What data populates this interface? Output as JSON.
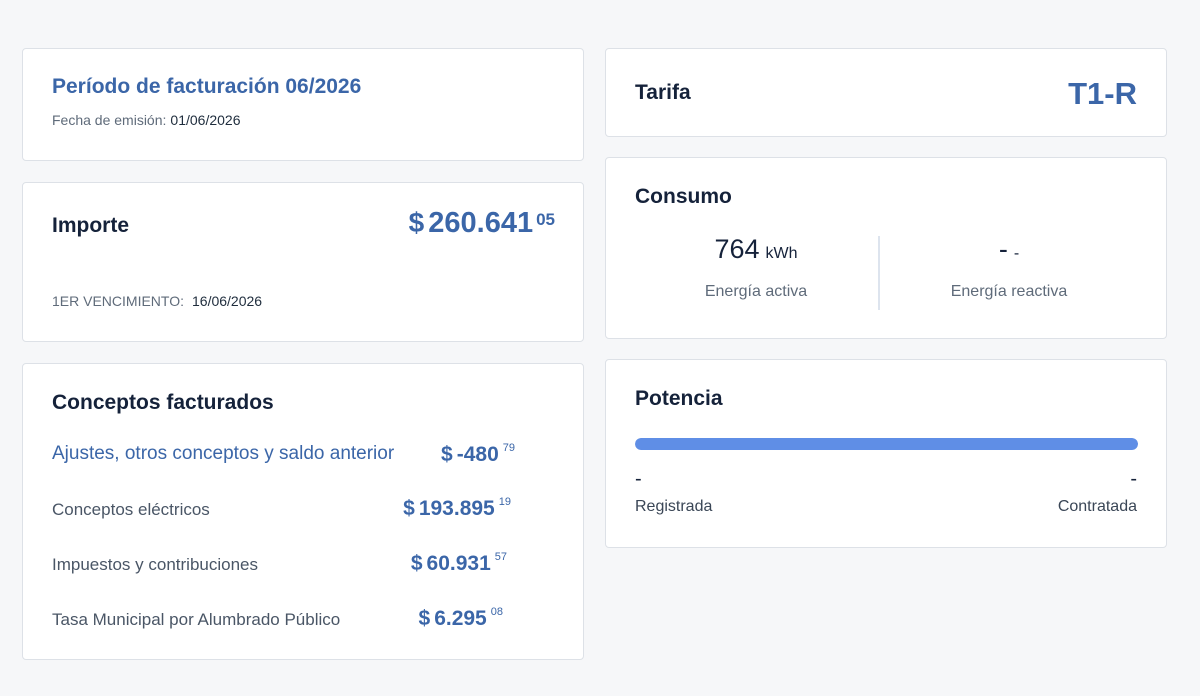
{
  "periodo": {
    "title": "Período de facturación 06/2026",
    "fecha_label": "Fecha de emisión:",
    "fecha_value": "01/06/2026"
  },
  "importe": {
    "title": "Importe",
    "currency": "$",
    "amount_int": "260.641",
    "amount_cents": "05",
    "vencimiento_label": "1ER VENCIMIENTO:",
    "vencimiento_value": "16/06/2026"
  },
  "conceptos": {
    "title": "Conceptos facturados",
    "items": [
      {
        "label": "Ajustes, otros conceptos y saldo anterior",
        "currency": "$",
        "int": "-480",
        "cents": "79"
      },
      {
        "label": "Conceptos eléctricos",
        "currency": "$",
        "int": "193.895",
        "cents": "19"
      },
      {
        "label": "Impuestos y contribuciones",
        "currency": "$",
        "int": "60.931",
        "cents": "57"
      },
      {
        "label": "Tasa Municipal por Alumbrado Público",
        "currency": "$",
        "int": "6.295",
        "cents": "08"
      }
    ]
  },
  "tarifa": {
    "title": "Tarifa",
    "value": "T1-R"
  },
  "consumo": {
    "title": "Consumo",
    "activa": {
      "value": "764",
      "unit": "kWh",
      "label": "Energía activa"
    },
    "reactiva": {
      "value": "-",
      "unit": "-",
      "label": "Energía reactiva"
    }
  },
  "potencia": {
    "title": "Potencia",
    "bar_fill_fraction": 1.0,
    "registrada_value": "-",
    "registrada_label": "Registrada",
    "contratada_value": "-",
    "contratada_label": "Contratada"
  },
  "colors": {
    "accent": "#3b66a8",
    "bar": "#5f8ee6",
    "background": "#f6f7f9"
  }
}
